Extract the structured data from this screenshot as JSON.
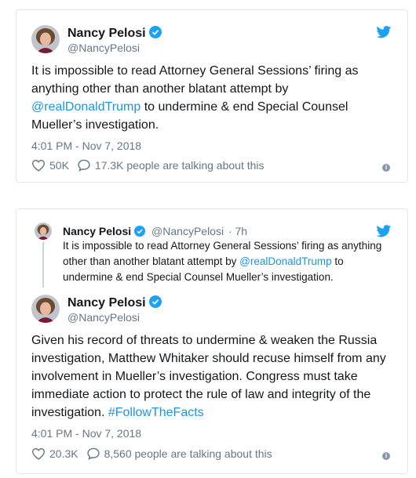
{
  "tweet1": {
    "name": "Nancy Pelosi",
    "handle": "@NancyPelosi",
    "text_part1": "It is impossible to read Attorney General Sessions’ firing as anything other than another blatant attempt by ",
    "mention": "@realDonaldTrump",
    "text_part2": " to undermine & end Special Counsel Mueller’s investigation.",
    "timestamp": "4:01 PM - Nov 7, 2018",
    "likes": "50K",
    "talking": "17.3K people are talking about this"
  },
  "tweet2": {
    "quoted": {
      "name": "Nancy Pelosi",
      "handle": "@NancyPelosi",
      "time": "· 7h",
      "text_part1": "It is impossible to read Attorney General Sessions’ firing as anything other than another blatant attempt by ",
      "mention": "@realDonaldTrump",
      "text_part2": " to undermine & end Special Counsel Mueller’s investigation."
    },
    "name": "Nancy Pelosi",
    "handle": "@NancyPelosi",
    "text_part1": "Given his record of threats to undermine & weaken the Russia investigation, Matthew Whitaker should recuse himself from any involvement in Mueller’s investigation. Congress must take immediate action to protect the rule of law and integrity of the investigation. ",
    "hashtag": "#FollowTheFacts",
    "timestamp": "4:01 PM - Nov 7, 2018",
    "likes": "20.3K",
    "talking": "8,560 people are talking about this"
  },
  "colors": {
    "link": "#1b95e0",
    "verified": "#1da1f2",
    "muted": "#657786"
  },
  "icons": {
    "logo": "twitter-bird-icon",
    "like": "heart-icon",
    "reply": "speech-bubble-icon",
    "info": "info-icon",
    "verified": "verified-badge-icon"
  }
}
